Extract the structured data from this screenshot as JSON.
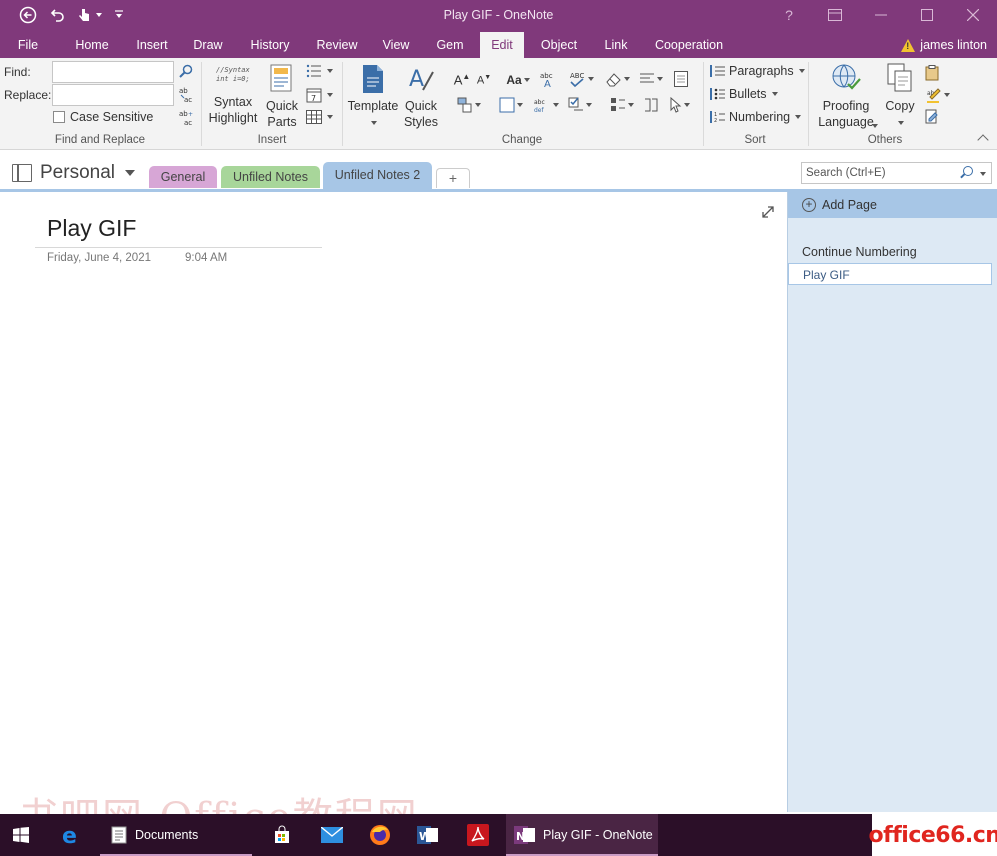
{
  "window": {
    "title": "Play GIF - OneNote",
    "help_glyph": "?"
  },
  "ribbon_tabs": [
    {
      "label": "File"
    },
    {
      "label": "Home"
    },
    {
      "label": "Insert"
    },
    {
      "label": "Draw"
    },
    {
      "label": "History"
    },
    {
      "label": "Review"
    },
    {
      "label": "View"
    },
    {
      "label": "Gem"
    },
    {
      "label": "Edit",
      "active": true
    },
    {
      "label": "Object"
    },
    {
      "label": "Link"
    },
    {
      "label": "Cooperation"
    }
  ],
  "user": {
    "name": "james linton"
  },
  "ribbon": {
    "find_replace": {
      "find_label": "Find:",
      "replace_label": "Replace:",
      "find_value": "",
      "replace_value": "",
      "case_sensitive_label": "Case Sensitive",
      "case_sensitive_checked": false,
      "group_label": "Find and Replace"
    },
    "insert_group": {
      "syntax_highlight": "Syntax\nHighlight",
      "syntax_icon_text": "//Syntax\nint i=0;",
      "quick_parts": "Quick\nParts",
      "group_label": "Insert"
    },
    "change_group": {
      "template": "Template",
      "quick_styles": "Quick\nStyles",
      "group_label": "Change"
    },
    "sort_group": {
      "paragraphs": "Paragraphs",
      "bullets": "Bullets",
      "numbering": "Numbering",
      "group_label": "Sort"
    },
    "others_group": {
      "proofing_language": "Proofing\nLanguage",
      "copy": "Copy",
      "group_label": "Others"
    }
  },
  "notebook": {
    "name": "Personal",
    "sections": [
      {
        "label": "General",
        "color": "#d7a6d6"
      },
      {
        "label": "Unfiled Notes",
        "color": "#a8d69a"
      },
      {
        "label": "Unfiled Notes 2",
        "color": "#a7c6e6",
        "active": true
      }
    ],
    "add_section_label": "+"
  },
  "search": {
    "placeholder": "Search (Ctrl+E)"
  },
  "page": {
    "title": "Play GIF",
    "date": "Friday, June 4, 2021",
    "time": "9:04 AM"
  },
  "page_pane": {
    "add_page_label": "Add Page",
    "pages": [
      {
        "label": "Continue Numbering",
        "selected": false
      },
      {
        "label": "Play GIF",
        "selected": true
      }
    ]
  },
  "watermark": {
    "text": "书吧网-Office教程网"
  },
  "taskbar": {
    "items": [
      {
        "label": "Documents",
        "icon": "file-explorer-icon"
      },
      {
        "label": "Play GIF - OneNote",
        "icon": "onenote-icon",
        "active": true
      }
    ],
    "brand": "office66.cn"
  },
  "colors": {
    "accent_purple": "#80397b",
    "pane_blue": "#dde9f4",
    "pane_header_blue": "#a7c6e6",
    "taskbar_bg": "#2b0f28"
  }
}
